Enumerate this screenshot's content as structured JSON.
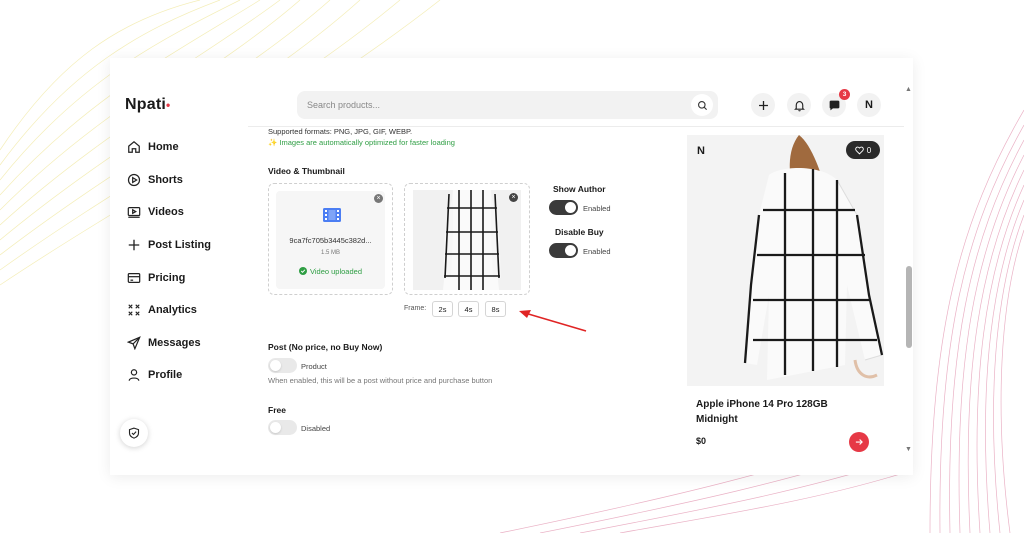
{
  "brand": {
    "name": "Npati",
    "dot": "•"
  },
  "nav": [
    {
      "label": "Home",
      "icon": "home-icon"
    },
    {
      "label": "Shorts",
      "icon": "play-circle-icon"
    },
    {
      "label": "Videos",
      "icon": "video-icon"
    },
    {
      "label": "Post Listing",
      "icon": "plus-icon"
    },
    {
      "label": "Pricing",
      "icon": "card-icon"
    },
    {
      "label": "Analytics",
      "icon": "analytics-icon"
    },
    {
      "label": "Messages",
      "icon": "send-icon"
    },
    {
      "label": "Profile",
      "icon": "user-icon"
    }
  ],
  "header": {
    "search_placeholder": "Search products...",
    "messages_badge": "3",
    "avatar": "N"
  },
  "upload": {
    "formats": "Supported formats: PNG, JPG, GIF, WEBP.",
    "optimized": "✨ Images are automatically optimized for faster loading"
  },
  "video": {
    "section_title": "Video & Thumbnail",
    "filename": "9ca7fc705b3445c382d...",
    "filesize": "1.5 MB",
    "status": "Video uploaded",
    "close": "×"
  },
  "frame": {
    "label": "Frame:",
    "options": [
      "2s",
      "4s",
      "8s"
    ]
  },
  "toggles": {
    "show_author": {
      "title": "Show Author",
      "state": "Enabled"
    },
    "disable_buy": {
      "title": "Disable Buy",
      "state": "Enabled"
    },
    "post": {
      "title": "Post (No price, no Buy Now)",
      "state": "Product",
      "helper": "When enabled, this will be a post without price and purchase button"
    },
    "free": {
      "title": "Free",
      "state": "Disabled"
    }
  },
  "product": {
    "author_initial": "N",
    "favorites": "0",
    "title": "Apple iPhone 14 Pro 128GB Midnight",
    "price": "$0"
  },
  "colors": {
    "accent": "#e63946",
    "success": "#2f9e44",
    "toggle_on": "#3a3a3a"
  }
}
